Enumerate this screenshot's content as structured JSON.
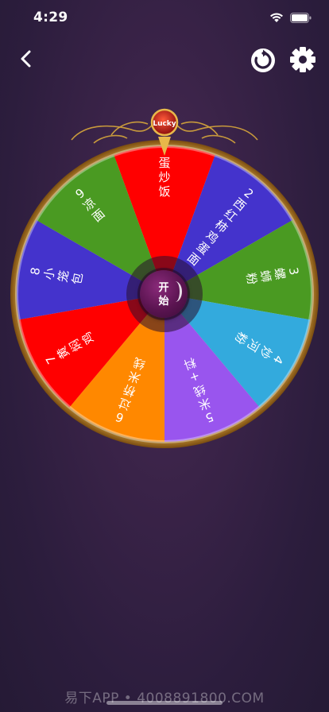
{
  "status": {
    "time": "4:29"
  },
  "nav": {
    "back_icon": "chevron-left-icon",
    "reset_icon": "rotate-icon",
    "settings_icon": "gear-icon"
  },
  "wheel": {
    "badge_text": "Lucky",
    "center_label_line1": "开",
    "center_label_line2": "始",
    "segments": [
      {
        "label": "蛋炒饭",
        "color": "#ff0000"
      },
      {
        "label": "2西红柿鸡蛋面",
        "color": "#4433cc"
      },
      {
        "label": "3螺蛳粉",
        "color": "#4a9a22"
      },
      {
        "label": "4炒河粉",
        "color": "#33aadd"
      },
      {
        "label": "5米线+料",
        "color": "#9955ee"
      },
      {
        "label": "6过桥米线",
        "color": "#ff8800"
      },
      {
        "label": "7黄焖鸡",
        "color": "#ff0000"
      },
      {
        "label": "8小笼包",
        "color": "#4433cc"
      },
      {
        "label": "9凉面",
        "color": "#4a9a22"
      }
    ]
  },
  "watermark": "易下APP • 4008891800.COM"
}
